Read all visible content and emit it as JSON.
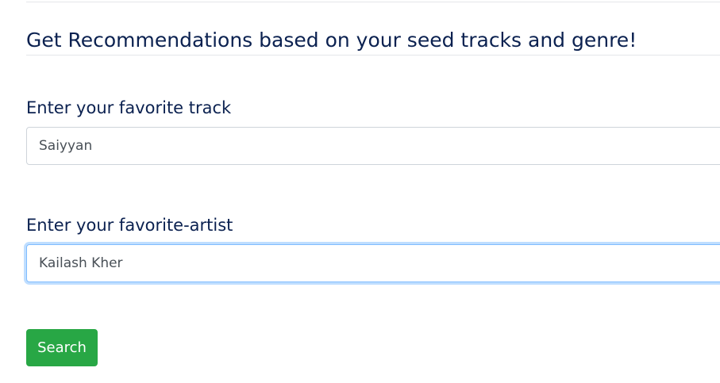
{
  "form": {
    "heading": "Get Recommendations based on your seed tracks and genre!",
    "track_label": "Enter your favorite track",
    "track_value": "Saiyyan",
    "artist_label": "Enter your favorite-artist",
    "artist_value": "Kailash Kher",
    "search_label": "Search"
  },
  "colors": {
    "heading_text": "#0b2150",
    "button_bg": "#28a745",
    "focus_border": "#80bdff"
  }
}
